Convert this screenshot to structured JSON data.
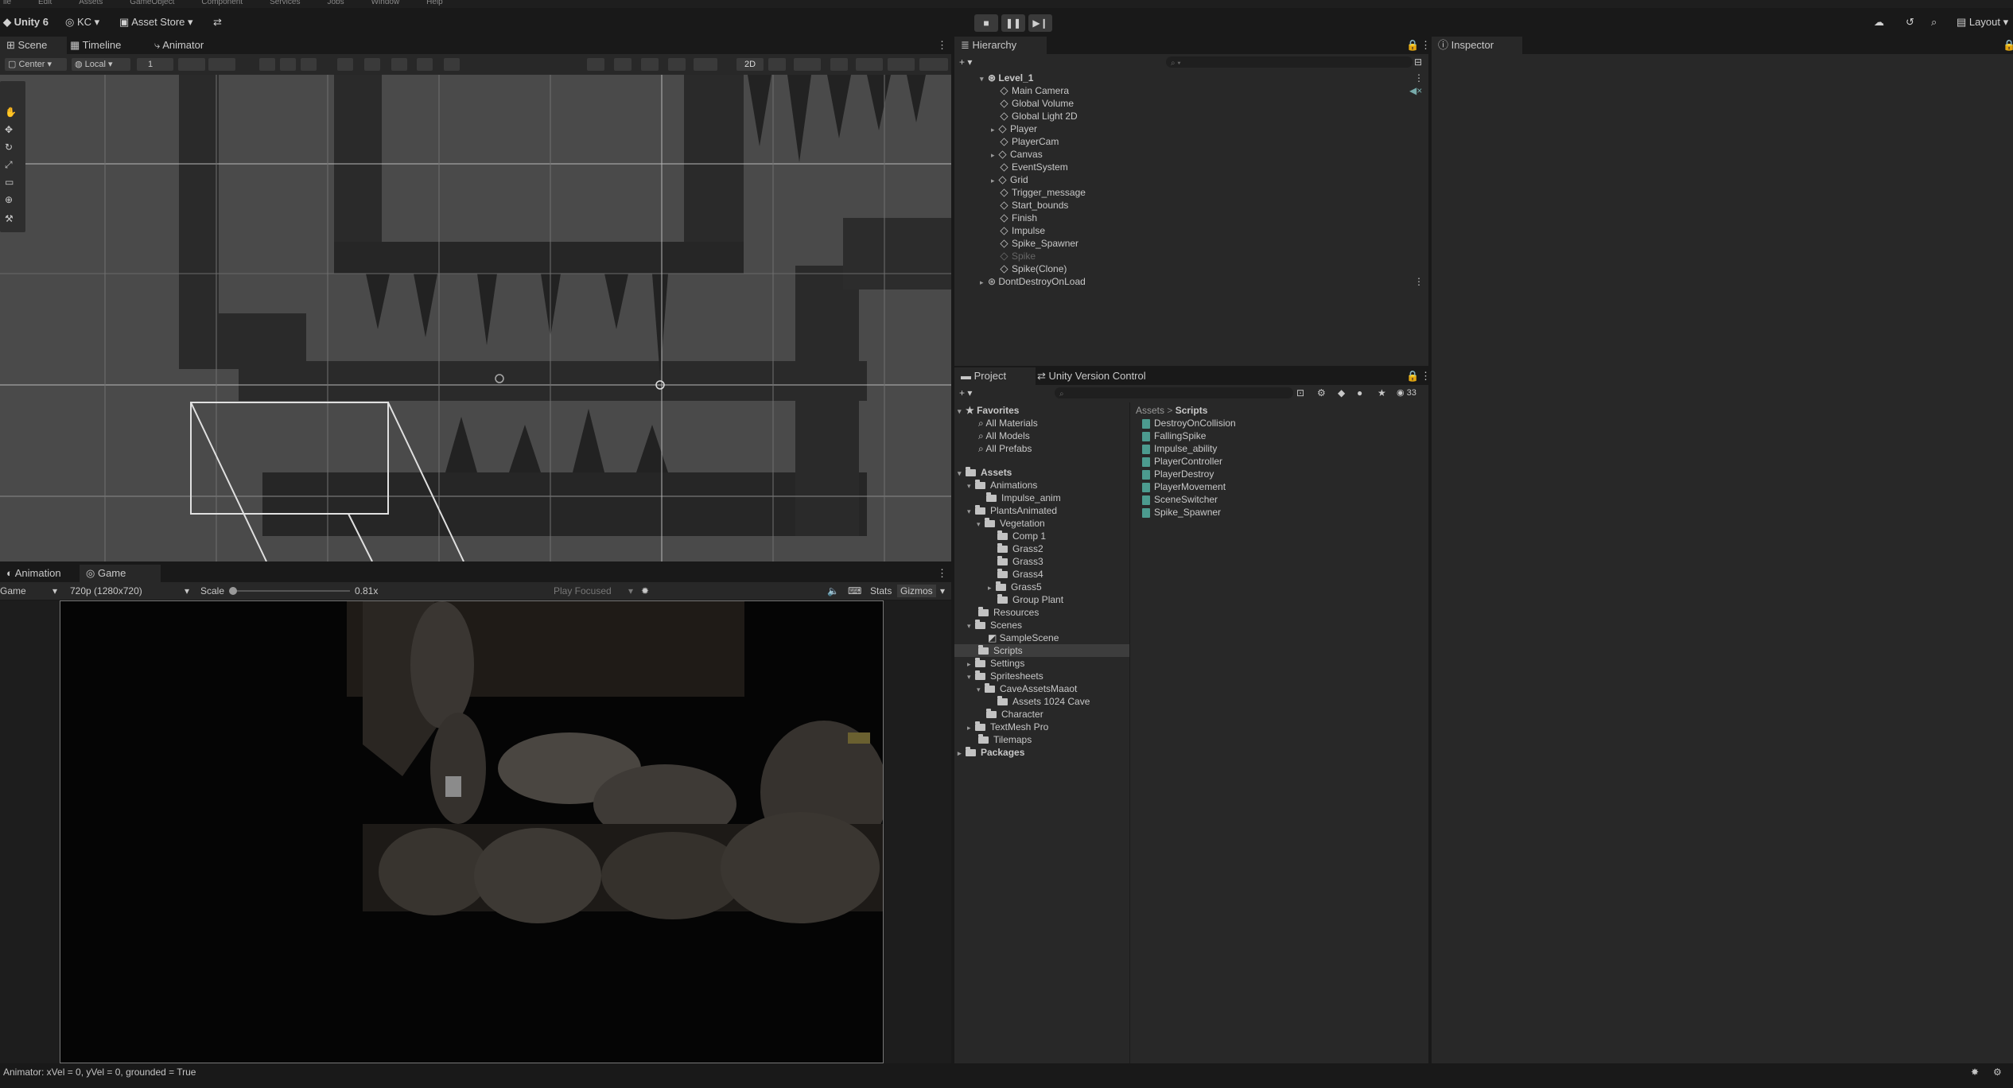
{
  "menu": [
    "ile",
    "Edit",
    "Assets",
    "GameObject",
    "Component",
    "Services",
    "Jobs",
    "Window",
    "Help"
  ],
  "toolbar": {
    "app_name": "Unity 6",
    "account": "KC",
    "asset_store": "Asset Store",
    "layout": "Layout"
  },
  "scene_tabs": [
    "Scene",
    "Timeline",
    "Animator"
  ],
  "scene_toolbar": {
    "pivot": "Center",
    "space": "Local",
    "grid_value": "1",
    "mode_2d": "2D"
  },
  "game_tabs": [
    "Animation",
    "Game"
  ],
  "game_toolbar": {
    "display": "Game",
    "resolution": "720p (1280x720)",
    "scale_label": "Scale",
    "scale_value": "0.81x",
    "play_mode": "Play Focused",
    "stats": "Stats",
    "gizmos": "Gizmos",
    "scale_fraction": 0.02
  },
  "hierarchy": {
    "tab": "Hierarchy",
    "scene": "Level_1",
    "items": [
      "Main Camera",
      "Global Volume",
      "Global Light 2D",
      "Player",
      "PlayerCam",
      "Canvas",
      "EventSystem",
      "Grid",
      "Trigger_message",
      "Start_bounds",
      "Finish",
      "Impulse",
      "Spike_Spawner",
      "Spike",
      "Spike(Clone)"
    ],
    "dont_destroy": "DontDestroyOnLoad"
  },
  "project": {
    "tabs": [
      "Project",
      "Unity Version Control"
    ],
    "count": "33",
    "favorites_label": "Favorites",
    "favorites": [
      "All Materials",
      "All Models",
      "All Prefabs"
    ],
    "assets_label": "Assets",
    "tree": [
      "Animations",
      "Impulse_anim",
      "PlantsAnimated",
      "Vegetation",
      "Comp 1",
      "Grass2",
      "Grass3",
      "Grass4",
      "Grass5",
      "Group Plant",
      "Resources",
      "Scenes",
      "SampleScene",
      "Scripts",
      "Settings",
      "Spritesheets",
      "CaveAssetsMaaot",
      "Assets 1024 Cave",
      "Character",
      "TextMesh Pro",
      "Tilemaps"
    ],
    "packages_label": "Packages",
    "breadcrumb_root": "Assets",
    "breadcrumb_current": "Scripts",
    "scripts": [
      "DestroyOnCollision",
      "FallingSpike",
      "Impulse_ability",
      "PlayerController",
      "PlayerDestroy",
      "PlayerMovement",
      "SceneSwitcher",
      "Spike_Spawner"
    ]
  },
  "inspector": {
    "tab": "Inspector"
  },
  "status": "Animator: xVel = 0, yVel = 0, grounded = True"
}
